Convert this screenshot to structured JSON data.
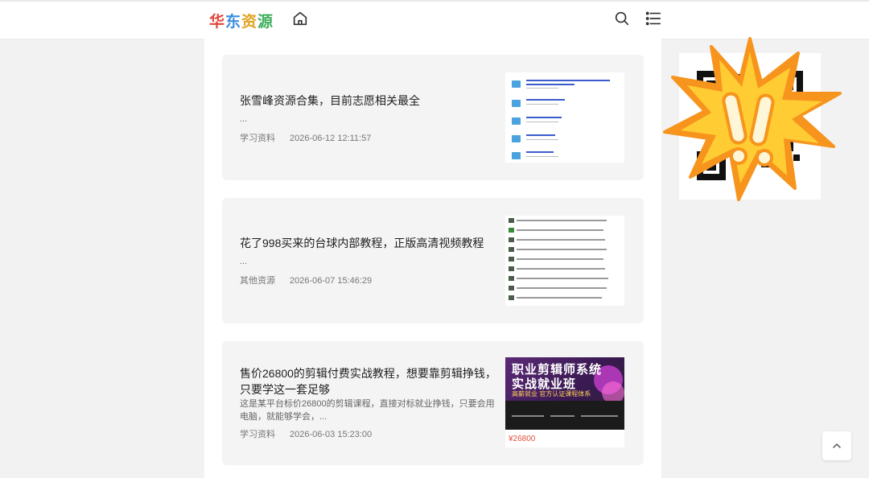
{
  "header": {
    "logo_chars": [
      "华",
      "东",
      "资",
      "源"
    ],
    "logo_colors": [
      "#e0453a",
      "#3a8de0",
      "#e2a31f",
      "#3fae5a"
    ]
  },
  "posts": [
    {
      "title": "张雪峰资源合集，目前志愿相关最全",
      "excerpt": "...",
      "category": "学习资料",
      "date": "2026-06-12 12:11:57"
    },
    {
      "title": "花了998买来的台球内部教程，正版高清视频教程",
      "excerpt": "...",
      "category": "其他资源",
      "date": "2026-06-07 15:46:29"
    },
    {
      "title": "售价26800的剪辑付费实战教程，想要靠剪辑挣钱，只要学这一套足够",
      "excerpt": "这是某平台标价26800的剪辑课程，直接对标就业挣钱，只要会用电脑，就能够学会，...",
      "category": "学习资料",
      "date": "2026-06-03 15:23:00",
      "thumb": {
        "line1": "职业剪辑师系统",
        "line2": "实战就业班",
        "line3": "高薪就业 官方认证课程体系",
        "price": "¥26800"
      }
    }
  ],
  "colors": {
    "card_bg": "#f4f4f4",
    "page_bg": "#f2f2f2",
    "burst_orange": "#f7941d",
    "burst_yellow": "#ffcc33"
  }
}
